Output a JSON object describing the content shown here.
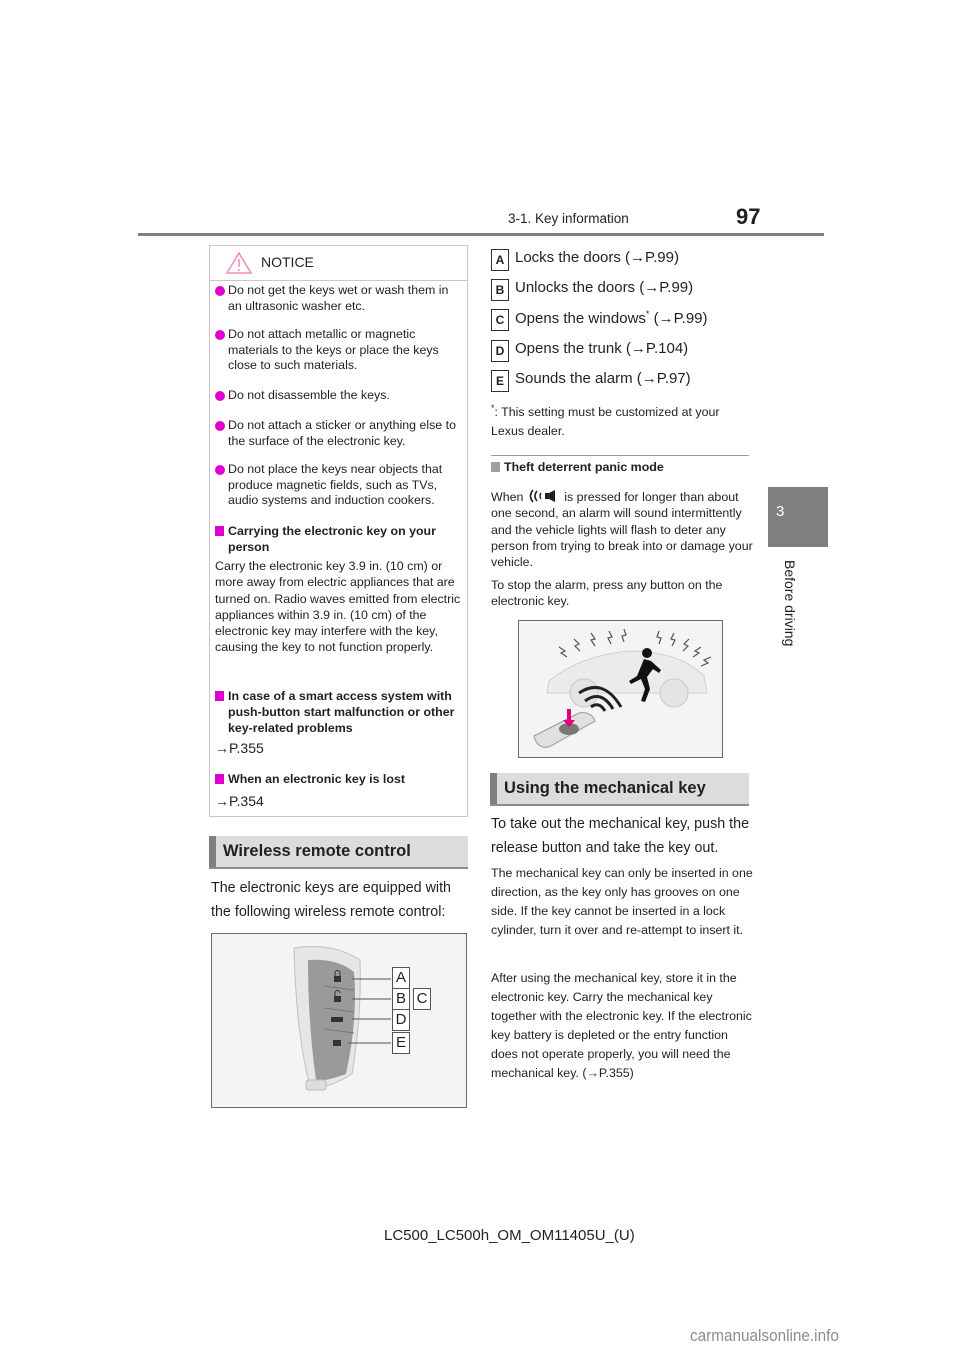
{
  "header": {
    "section": "3-1. Key information",
    "page_number": "97"
  },
  "side_tab": {
    "chapter_number": "3",
    "chapter_title": "Before driving"
  },
  "notice": {
    "title": "NOTICE",
    "icon": "warning-triangle-icon",
    "bullets": [
      "Do not get the keys wet or wash them in an ultrasonic washer etc.",
      "Do not attach metallic or magnetic materials to the keys or place the keys close to such materials.",
      "Do not disassemble the keys.",
      "Do not attach a sticker or anything else to the surface of the electronic key.",
      "Do not place the keys near objects that produce magnetic fields, such as TVs, audio systems and induction cookers."
    ],
    "subsections": [
      {
        "heading": "Carrying the electronic key on your person",
        "body": "Carry the electronic key 3.9 in. (10 cm) or more away from electric appliances that are turned on. Radio waves emitted from electric appliances within 3.9 in. (10 cm) of the electronic key may interfere with the key, causing the key to not function properly."
      },
      {
        "heading": "In case of a smart access system with push-button start malfunction or other key-related problems",
        "ref": "→P.355"
      },
      {
        "heading": "When an electronic key is lost",
        "ref": "→P.354"
      }
    ]
  },
  "wireless_section": {
    "title": "Wireless remote control",
    "intro": "The electronic keys are equipped with the following wireless remote control:",
    "figure_labels": [
      "A",
      "B",
      "C",
      "D",
      "E"
    ]
  },
  "functions": [
    {
      "badge": "A",
      "text": "Locks the doors (→P.99)"
    },
    {
      "badge": "B",
      "text": "Unlocks the doors (→P.99)"
    },
    {
      "badge": "C",
      "text": "Opens the windows",
      "sup": "*",
      "text2": " (→P.99)"
    },
    {
      "badge": "D",
      "text": "Opens the trunk (→P.104)"
    },
    {
      "badge": "E",
      "text": "Sounds the alarm (→P.97)"
    }
  ],
  "footnote": {
    "mark": "*",
    "text": ": This setting must be customized at your Lexus dealer."
  },
  "panic_mode": {
    "heading": "Theft deterrent panic mode",
    "para1_before_icon": "When",
    "para1_icon": "panic-alarm-icon",
    "para1_after_icon": "is pressed for longer than about one second, an alarm will sound intermittently and the vehicle lights will flash to deter any person from trying to break into or damage your vehicle.",
    "para2": "To stop the alarm, press any button on the electronic key."
  },
  "mechanical_section": {
    "title": "Using the mechanical key",
    "intro": "To take out the mechanical key, push the release button and take the key out.",
    "para1": "The mechanical key can only be inserted in one direction, as the key only has grooves on one side. If the key cannot be inserted in a lock cylinder, turn it over and re-attempt to insert it.",
    "para2": "After using the mechanical key, store it in the electronic key. Carry the mechanical key together with the electronic key. If the electronic key battery is depleted or the entry function does not operate properly, you will need the mechanical key. (→P.355)"
  },
  "footer": {
    "code": "LC500_LC500h_OM_OM11405U_(U)",
    "watermark": "carmanualsonline.info"
  },
  "colors": {
    "accent_magenta": "#e000d4",
    "header_rule": "#808080",
    "section_bg": "#dcdcdc"
  }
}
